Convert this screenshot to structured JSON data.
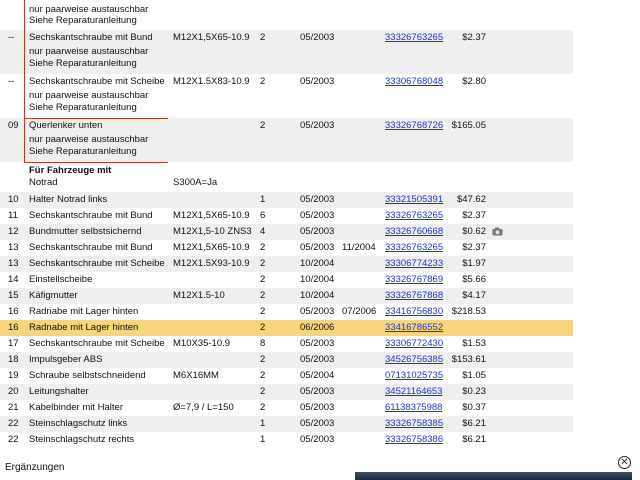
{
  "rows": [
    {
      "nr": "",
      "desc": "",
      "info": "",
      "qty": "",
      "from": "",
      "to": "",
      "part": "",
      "price": "",
      "notes": [
        "nur paarweise austauschbar",
        "Siehe Reparaturanleitung"
      ]
    },
    {
      "nr": "--",
      "desc": "Sechskantschraube mit Bund",
      "info": "M12X1,5X65-10.9",
      "qty": "2",
      "from": "05/2003",
      "to": "",
      "part": "33326763265",
      "price": "$2.37",
      "notes": [
        "nur paarweise austauschbar",
        "Siehe Reparaturanleitung"
      ]
    },
    {
      "nr": "--",
      "desc": "Sechskantschraube mit Scheibe",
      "info": "M12X1.5X83-10.9",
      "qty": "2",
      "from": "05/2003",
      "to": "",
      "part": "33306768048",
      "price": "$2.80",
      "notes": [
        "nur paarweise austauschbar",
        "Siehe Reparaturanleitung"
      ]
    },
    {
      "nr": "09",
      "desc": "Querlenker unten",
      "info": "",
      "qty": "2",
      "from": "05/2003",
      "to": "",
      "part": "33326768726",
      "price": "$165.05",
      "notes": [
        "nur paarweise austauschbar",
        "Siehe Reparaturanleitung"
      ]
    },
    {
      "nr": "",
      "desc": "Für Fahrzeuge mit",
      "desc2": "Notrad",
      "info": "S300A=Ja"
    },
    {
      "nr": "10",
      "desc": "Halter Notrad links",
      "info": "",
      "qty": "1",
      "from": "05/2003",
      "to": "",
      "part": "33321505391",
      "price": "$47.62"
    },
    {
      "nr": "11",
      "desc": "Sechskantschraube mit Bund",
      "info": "M12X1,5X65-10.9",
      "qty": "6",
      "from": "05/2003",
      "to": "",
      "part": "33326763265",
      "price": "$2.37"
    },
    {
      "nr": "12",
      "desc": "Bundmutter selbstsichernd",
      "info": "M12X1,5-10 ZNS3",
      "qty": "4",
      "from": "05/2003",
      "to": "",
      "part": "33326760668",
      "price": "$0.62"
    },
    {
      "nr": "13",
      "desc": "Sechskantschraube mit Bund",
      "info": "M12X1,5X65-10.9",
      "qty": "2",
      "from": "05/2003",
      "to": "11/2004",
      "part": "33326763265",
      "price": "$2.37"
    },
    {
      "nr": "13",
      "desc": "Sechskantschraube mit Scheibe",
      "info": "M12X1.5X93-10.9",
      "qty": "2",
      "from": "10/2004",
      "to": "",
      "part": "33306774233",
      "price": "$1.97"
    },
    {
      "nr": "14",
      "desc": "Einstellscheibe",
      "info": "",
      "qty": "2",
      "from": "10/2004",
      "to": "",
      "part": "33326767869",
      "price": "$5.66"
    },
    {
      "nr": "15",
      "desc": "Käfigmutter",
      "info": "M12X1.5-10",
      "qty": "2",
      "from": "10/2004",
      "to": "",
      "part": "33326767868",
      "price": "$4.17"
    },
    {
      "nr": "16",
      "desc": "Radnabe mit Lager hinten",
      "info": "",
      "qty": "2",
      "from": "05/2003",
      "to": "07/2006",
      "part": "33416756830",
      "price": "$218.53"
    },
    {
      "nr": "16",
      "desc": "Radnabe mit Lager hinten",
      "info": "",
      "qty": "2",
      "from": "06/2006",
      "to": "",
      "part": "33416786552",
      "price": ""
    },
    {
      "nr": "17",
      "desc": "Sechskantschraube mit Scheibe",
      "info": "M10X35-10.9",
      "qty": "8",
      "from": "05/2003",
      "to": "",
      "part": "33306772430",
      "price": "$1.53"
    },
    {
      "nr": "18",
      "desc": "Impulsgeber ABS",
      "info": "",
      "qty": "2",
      "from": "05/2003",
      "to": "",
      "part": "34526756385",
      "price": "$153.61"
    },
    {
      "nr": "19",
      "desc": "Schraube selbstschneidend",
      "info": "M6X16MM",
      "qty": "2",
      "from": "05/2004",
      "to": "",
      "part": "07131025735",
      "price": "$1.05"
    },
    {
      "nr": "20",
      "desc": "Leitungshalter",
      "info": "",
      "qty": "2",
      "from": "05/2003",
      "to": "",
      "part": "34521164653",
      "price": "$0.23"
    },
    {
      "nr": "21",
      "desc": "Kabelbinder mit Halter",
      "info": "Ø=7,9 / L=150",
      "qty": "2",
      "from": "05/2003",
      "to": "",
      "part": "61138375988",
      "price": "$0.37"
    },
    {
      "nr": "22",
      "desc": "Steinschlagschutz links",
      "info": "",
      "qty": "1",
      "from": "05/2003",
      "to": "",
      "part": "33326758385",
      "price": "$6.21"
    },
    {
      "nr": "22",
      "desc": "Steinschlagschutz rechts",
      "info": "",
      "qty": "1",
      "from": "05/2003",
      "to": "",
      "part": "33326758386",
      "price": "$6.21"
    }
  ],
  "footer": {
    "label": "Ergänzungen",
    "close_icon": "close-icon"
  },
  "colors": {
    "highlight": "#f6d57c",
    "alt_row": "#efefef",
    "link": "#1a35c9",
    "bracket": "#c0392b"
  }
}
